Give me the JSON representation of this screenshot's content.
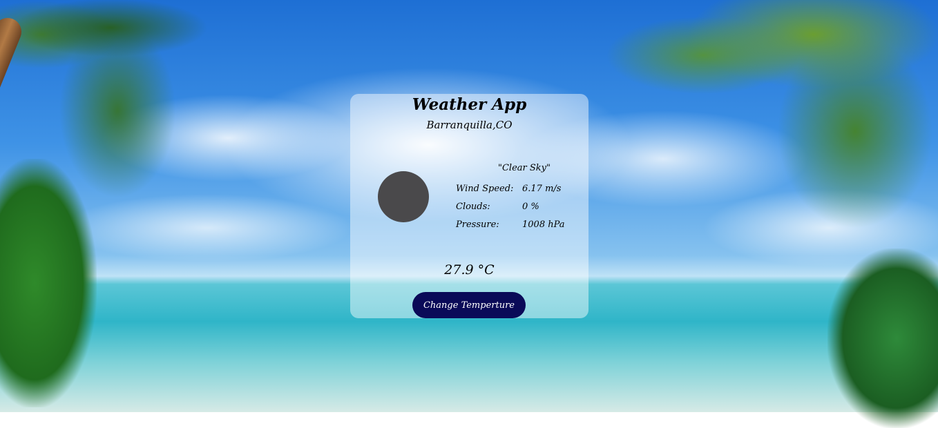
{
  "app": {
    "title": "Weather App",
    "location": "Barranquilla,CO"
  },
  "weather": {
    "description": "\"Clear Sky\"",
    "icon": "weather-condition-circle",
    "stats": [
      {
        "label": "Wind Speed:",
        "value": "6.17 m/s"
      },
      {
        "label": "Clouds:",
        "value": "0 %"
      },
      {
        "label": "Pressure:",
        "value": "1008 hPa"
      }
    ],
    "temperature": "27.9 °C"
  },
  "controls": {
    "toggle_label": "Change Temperture"
  },
  "colors": {
    "button_background": "#0a0a58",
    "button_text": "#ffffff",
    "icon_fill": "#4a494b"
  }
}
